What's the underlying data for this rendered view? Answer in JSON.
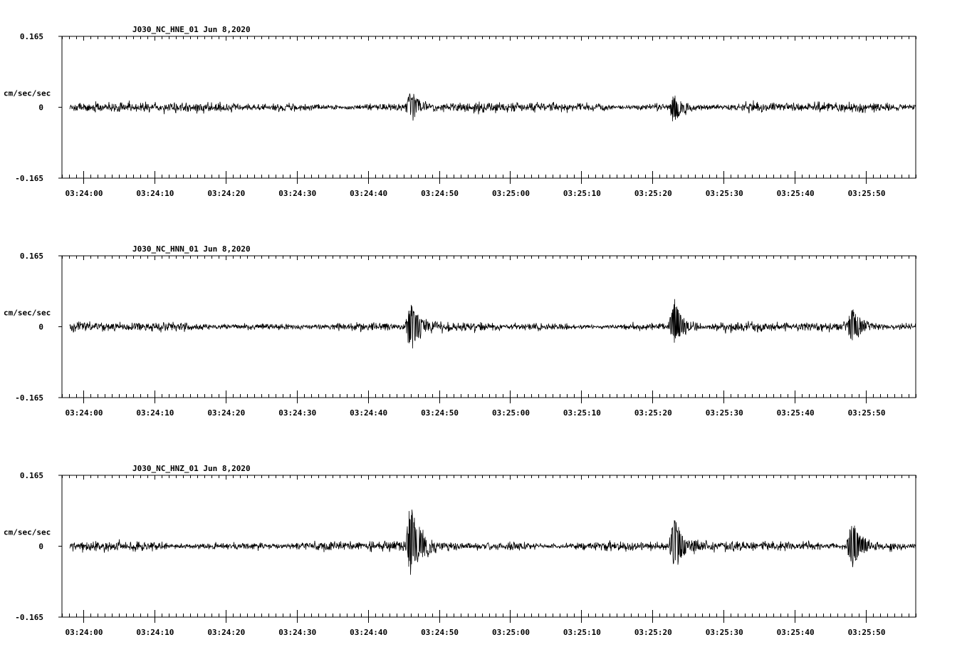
{
  "chart_data": [
    {
      "type": "line",
      "title": "J030_NC_HNE_01   Jun 8,2020",
      "channel": "J030_NC_HNE_01",
      "date": "Jun 8,2020",
      "ylabel": "cm/sec/sec",
      "ylim": [
        -0.165,
        0.165
      ],
      "y_tick_labels": [
        "0.165",
        "0",
        "-0.165"
      ],
      "x_tick_labels": [
        "03:24:00",
        "03:24:10",
        "03:24:20",
        "03:24:30",
        "03:24:40",
        "03:24:50",
        "03:25:00",
        "03:25:10",
        "03:25:20",
        "03:25:30",
        "03:25:40",
        "03:25:50"
      ],
      "x_range_seconds_after_03:24:00": [
        -3,
        117
      ],
      "noise_amplitude": 0.012,
      "events": [
        {
          "time": "03:24:46",
          "peak": 0.045,
          "trough": -0.035
        },
        {
          "time": "03:25:23",
          "peak": 0.03,
          "trough": -0.045
        }
      ]
    },
    {
      "type": "line",
      "title": "J030_NC_HNN_01   Jun 8,2020",
      "channel": "J030_NC_HNN_01",
      "date": "Jun 8,2020",
      "ylabel": "cm/sec/sec",
      "ylim": [
        -0.165,
        0.165
      ],
      "y_tick_labels": [
        "0.165",
        "0",
        "-0.165"
      ],
      "x_tick_labels": [
        "03:24:00",
        "03:24:10",
        "03:24:20",
        "03:24:30",
        "03:24:40",
        "03:24:50",
        "03:25:00",
        "03:25:10",
        "03:25:20",
        "03:25:30",
        "03:25:40",
        "03:25:50"
      ],
      "x_range_seconds_after_03:24:00": [
        -3,
        117
      ],
      "noise_amplitude": 0.011,
      "events": [
        {
          "time": "03:24:46",
          "peak": 0.07,
          "trough": -0.07
        },
        {
          "time": "03:25:23",
          "peak": 0.08,
          "trough": -0.055
        },
        {
          "time": "03:25:48",
          "peak": 0.055,
          "trough": -0.045
        }
      ]
    },
    {
      "type": "line",
      "title": "J030_NC_HNZ_01   Jun 8,2020",
      "channel": "J030_NC_HNZ_01",
      "date": "Jun 8,2020",
      "ylabel": "cm/sec/sec",
      "ylim": [
        -0.165,
        0.165
      ],
      "y_tick_labels": [
        "0.165",
        "0",
        "-0.165"
      ],
      "x_tick_labels": [
        "03:24:00",
        "03:24:10",
        "03:24:20",
        "03:24:30",
        "03:24:40",
        "03:24:50",
        "03:25:00",
        "03:25:10",
        "03:25:20",
        "03:25:30",
        "03:25:40",
        "03:25:50"
      ],
      "x_range_seconds_after_03:24:00": [
        -3,
        117
      ],
      "noise_amplitude": 0.013,
      "events": [
        {
          "time": "03:24:46",
          "peak": 0.115,
          "trough": -0.08
        },
        {
          "time": "03:25:23",
          "peak": 0.08,
          "trough": -0.065
        },
        {
          "time": "03:25:48",
          "peak": 0.08,
          "trough": -0.06
        }
      ]
    }
  ]
}
